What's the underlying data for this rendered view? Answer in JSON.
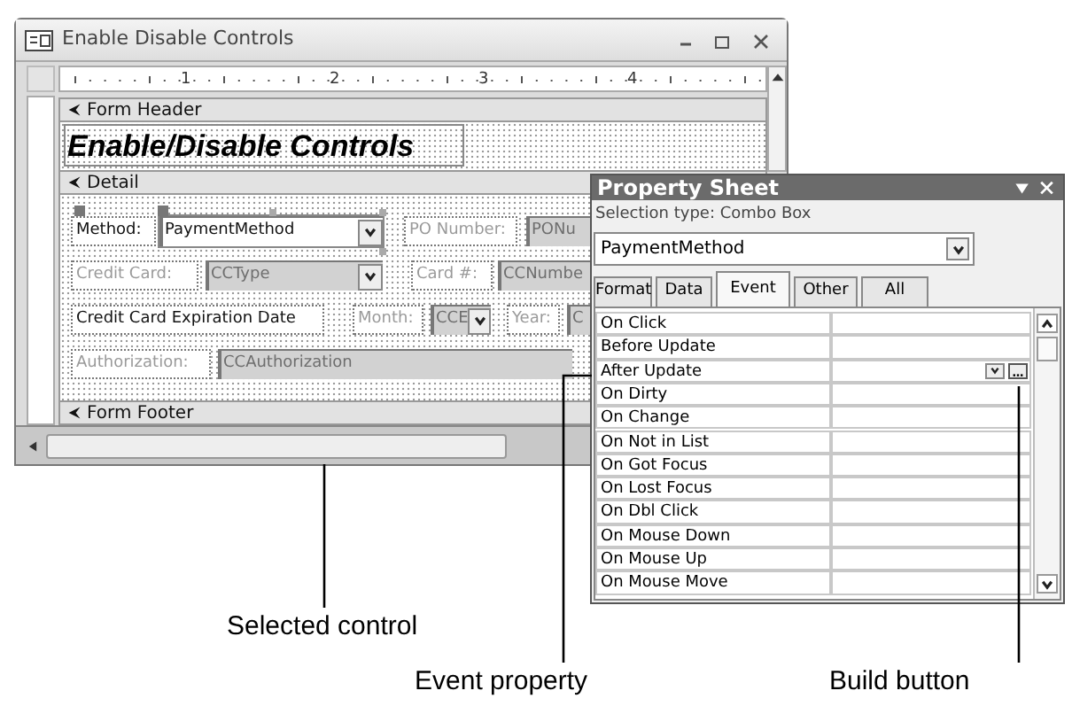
{
  "window": {
    "title": "Enable Disable Controls"
  },
  "ruler": [
    "1",
    "2",
    "3",
    "4"
  ],
  "sections": [
    {
      "label": "Form Header"
    },
    {
      "label": "Detail"
    },
    {
      "label": "Form Footer"
    }
  ],
  "form_title": "Enable/Disable Controls",
  "controls": [
    {
      "kind": "label",
      "text": "Method:",
      "disabled": false,
      "selected": false
    },
    {
      "kind": "combo",
      "text": "PaymentMethod",
      "disabled": false,
      "selected": true
    },
    {
      "kind": "label",
      "text": "PO Number:",
      "disabled": true,
      "selected": false
    },
    {
      "kind": "textbox",
      "text": "PONu",
      "disabled": true,
      "selected": false
    },
    {
      "kind": "label",
      "text": "Credit Card:",
      "disabled": true,
      "selected": false
    },
    {
      "kind": "combo",
      "text": "CCType",
      "disabled": true,
      "selected": false
    },
    {
      "kind": "label",
      "text": "Card #:",
      "disabled": true,
      "selected": false
    },
    {
      "kind": "textbox",
      "text": "CCNumbe",
      "disabled": true,
      "selected": false
    },
    {
      "kind": "label",
      "text": "Credit Card Expiration Date",
      "disabled": false,
      "selected": false
    },
    {
      "kind": "label",
      "text": "Month:",
      "disabled": true,
      "selected": false
    },
    {
      "kind": "combo",
      "text": "CCE",
      "disabled": true,
      "selected": false
    },
    {
      "kind": "label",
      "text": "Year:",
      "disabled": true,
      "selected": false
    },
    {
      "kind": "textbox",
      "text": "C",
      "disabled": true,
      "selected": false
    },
    {
      "kind": "label",
      "text": "Authorization:",
      "disabled": true,
      "selected": false
    },
    {
      "kind": "textbox",
      "text": "CCAuthorization",
      "disabled": true,
      "selected": false
    }
  ],
  "property_sheet": {
    "title": "Property Sheet",
    "selection_type": "Selection type:  Combo Box",
    "object": "PaymentMethod",
    "tabs": [
      {
        "label": "Format",
        "selected": false
      },
      {
        "label": "Data",
        "selected": false
      },
      {
        "label": "Event",
        "selected": true
      },
      {
        "label": "Other",
        "selected": false
      },
      {
        "label": "All",
        "selected": false
      }
    ],
    "rows": [
      {
        "label": "On Click",
        "kind": "plain"
      },
      {
        "label": "Before Update",
        "kind": "plain"
      },
      {
        "label": "After Update",
        "kind": "builder"
      },
      {
        "label": "On Dirty",
        "kind": "plain"
      },
      {
        "label": "On Change",
        "kind": "plain"
      },
      {
        "label": "On Not in List",
        "kind": "plain"
      },
      {
        "label": "On Got Focus",
        "kind": "plain"
      },
      {
        "label": "On Lost Focus",
        "kind": "plain"
      },
      {
        "label": "On Dbl Click",
        "kind": "plain"
      },
      {
        "label": "On Mouse Down",
        "kind": "plain"
      },
      {
        "label": "On Mouse Up",
        "kind": "plain"
      },
      {
        "label": "On Mouse Move",
        "kind": "plain"
      }
    ]
  },
  "callouts": [
    "Selected control",
    "Event property",
    "Build button"
  ]
}
